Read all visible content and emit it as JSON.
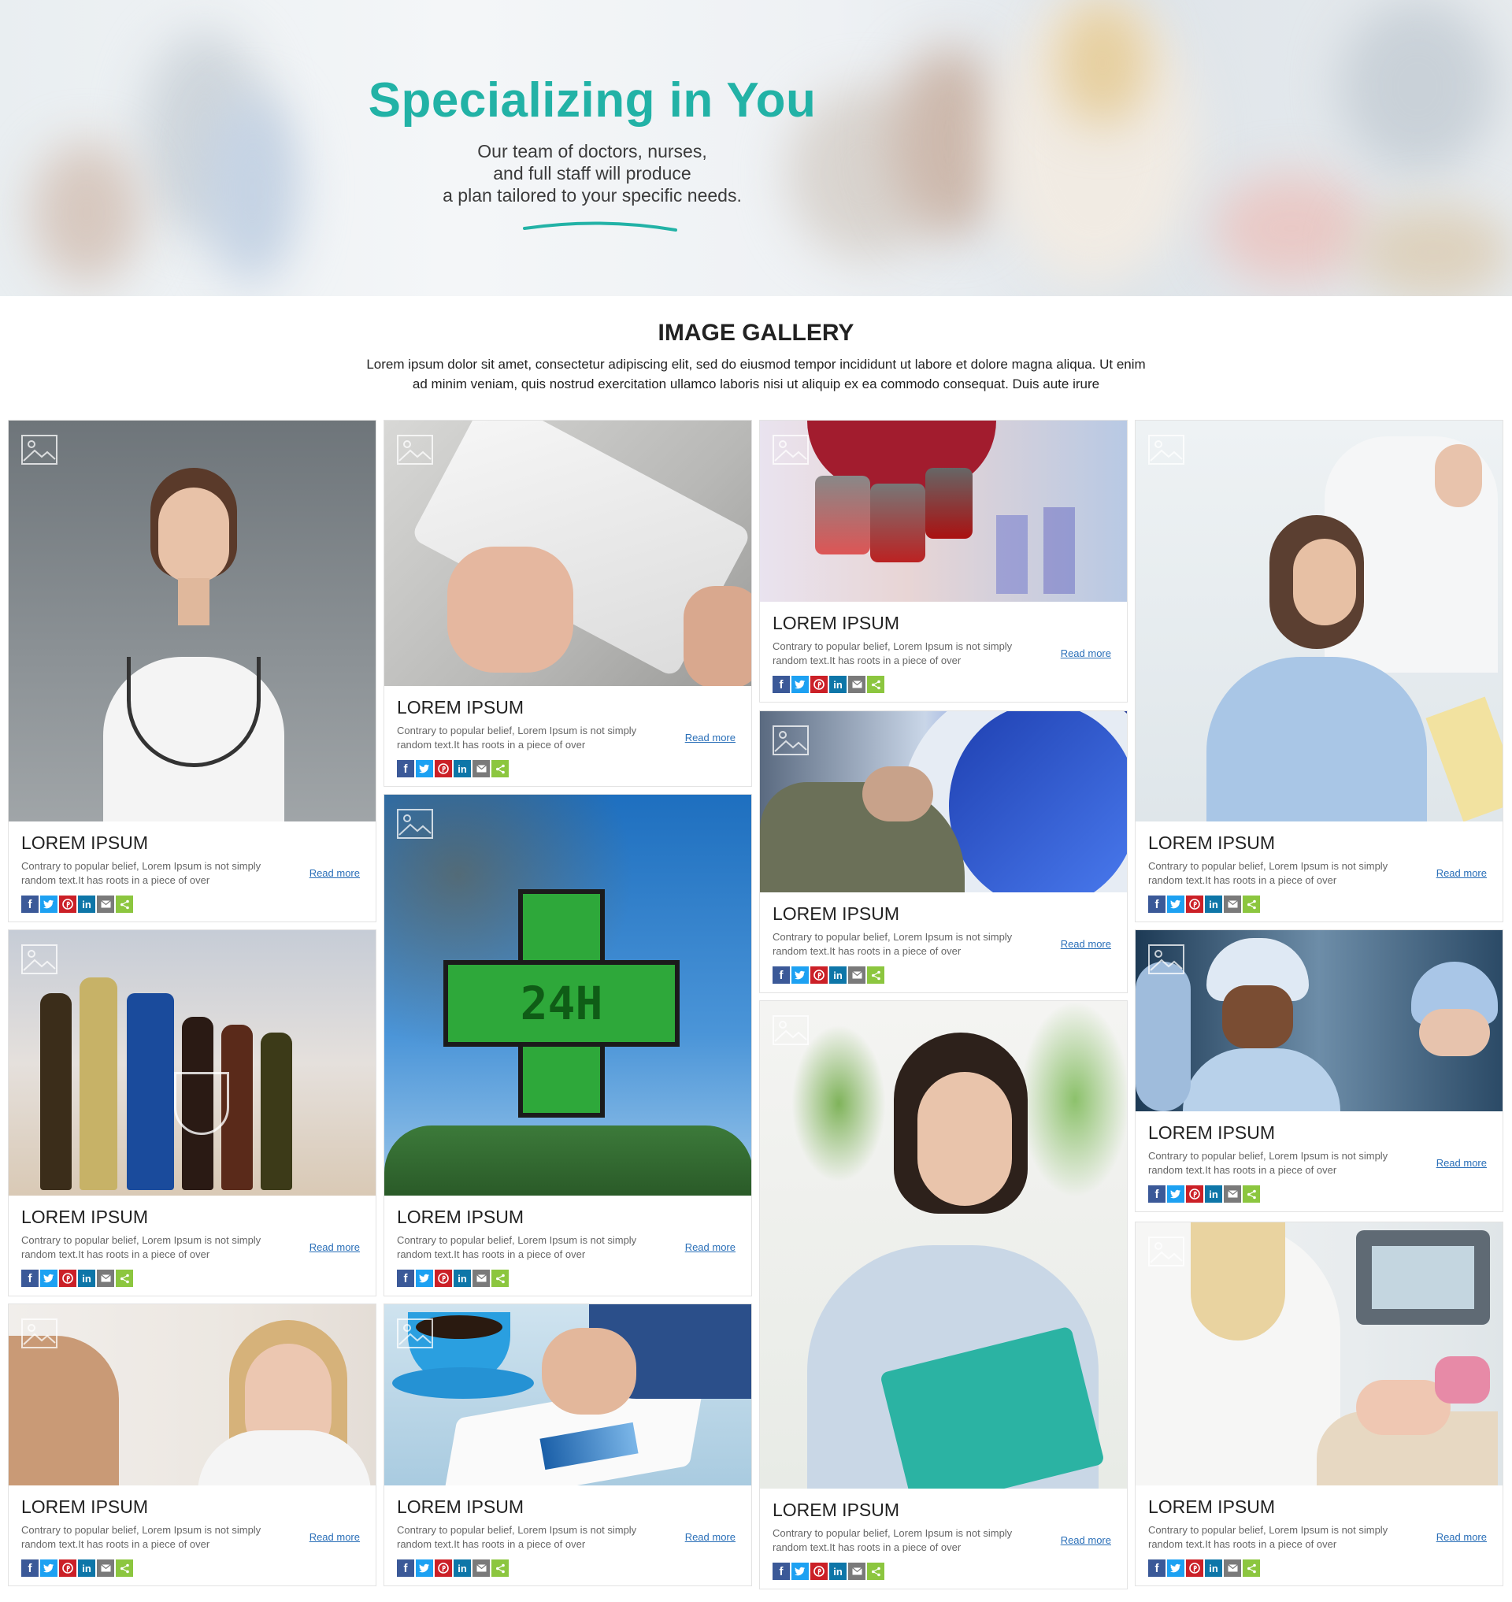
{
  "hero": {
    "title": "Specializing in You",
    "subtitle_lines": [
      "Our team of doctors, nurses,",
      "and full staff will produce",
      "a plan tailored to your specific needs."
    ],
    "accent_color": "#22b2a6"
  },
  "gallery": {
    "title": "IMAGE GALLERY",
    "description_lines": [
      "Lorem ipsum dolor sit amet, consectetur adipiscing elit, sed do eiusmod tempor incididunt ut labore et dolore magna aliqua. Ut enim",
      "ad minim veniam, quis nostrud exercitation ullamco laboris nisi ut aliquip ex ea commodo consequat. Duis aute irure"
    ],
    "card_text_line1": "Contrary to popular belief, Lorem Ipsum is not simply",
    "card_text_line2": "random text.It has roots in a piece of over",
    "read_more": "Read more",
    "social_icons": [
      {
        "name": "facebook-icon",
        "color": "#3b5998"
      },
      {
        "name": "twitter-icon",
        "color": "#1da1f2"
      },
      {
        "name": "pinterest-icon",
        "color": "#cb2027"
      },
      {
        "name": "linkedin-icon",
        "color": "#0e76a8"
      },
      {
        "name": "email-icon",
        "color": "#7a7a7a"
      },
      {
        "name": "share-icon",
        "color": "#8cc63f"
      }
    ],
    "cards": [
      {
        "id": "c1",
        "title": "LOREM IPSUM",
        "image": "doctor-woman-stethoscope"
      },
      {
        "id": "c2",
        "title": "LOREM IPSUM",
        "image": "hand-holding-tablet"
      },
      {
        "id": "c3",
        "title": "LOREM IPSUM",
        "image": "microscope-lenses"
      },
      {
        "id": "c4",
        "title": "LOREM IPSUM",
        "image": "doctor-with-patient"
      },
      {
        "id": "c5",
        "title": "LOREM IPSUM",
        "image": "mri-scanner-patient"
      },
      {
        "id": "c6",
        "title": "LOREM IPSUM",
        "image": "bottles-and-glass"
      },
      {
        "id": "c7",
        "title": "LOREM IPSUM",
        "image": "pharmacy-cross-24h"
      },
      {
        "id": "c8",
        "title": "LOREM IPSUM",
        "image": "surgeons-team"
      },
      {
        "id": "c9",
        "title": "LOREM IPSUM",
        "image": "woman-writing-notebook"
      },
      {
        "id": "c10",
        "title": "LOREM IPSUM",
        "image": "female-doctor-portrait"
      },
      {
        "id": "c11",
        "title": "LOREM IPSUM",
        "image": "coffee-and-tablet"
      },
      {
        "id": "c12",
        "title": "LOREM IPSUM",
        "image": "cosmetic-treatment"
      }
    ]
  }
}
